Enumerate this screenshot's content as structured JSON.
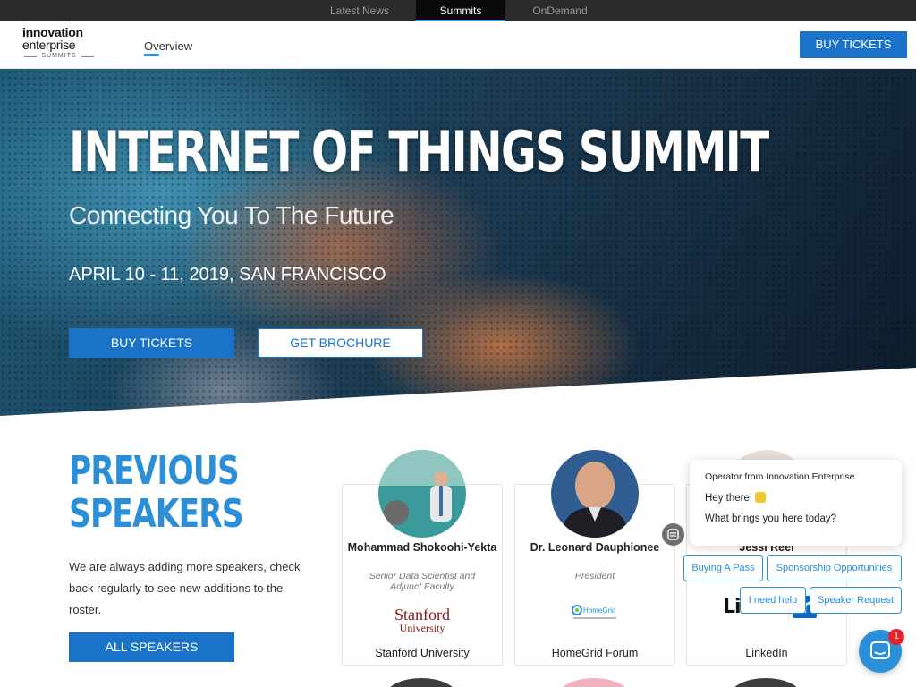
{
  "topnav": {
    "items": [
      "Latest News",
      "Summits",
      "OnDemand"
    ],
    "active": "Summits"
  },
  "header": {
    "logo": {
      "line1": "innovation",
      "line2": "enterprise",
      "line3": "SUMMITS"
    },
    "nav_overview": "Overview",
    "buy_tickets": "BUY TICKETS"
  },
  "hero": {
    "title": "INTERNET OF THINGS SUMMIT",
    "subtitle": "Connecting You To The Future",
    "date": "APRIL 10 - 11, 2019, SAN FRANCISCO",
    "buy_tickets": "BUY TICKETS",
    "get_brochure": "GET BROCHURE"
  },
  "speakers_section": {
    "title_line1": "PREVIOUS",
    "title_line2": "SPEAKERS",
    "description": "We are always adding more speakers, check back regularly to see new additions to the roster.",
    "all_speakers": "ALL SPEAKERS",
    "speakers": [
      {
        "name": "Mohammad Shokoohi-Yekta",
        "role": "Senior Data Scientist and Adjunct Faculty",
        "company": "Stanford University",
        "logo_line1": "Stanford",
        "logo_line2": "University"
      },
      {
        "name": "Dr. Leonard Dauphionee",
        "role": "President",
        "company": "HomeGrid Forum",
        "logo_text": "HomeGrid"
      },
      {
        "name": "Jessi Reel",
        "role": "",
        "company": "LinkedIn",
        "logo_text": "Linked",
        "logo_in": "in"
      }
    ]
  },
  "chat": {
    "operator": "Operator from Innovation Enterprise",
    "line1": "Hey there!",
    "line2": "What brings you here today?",
    "quick_replies": [
      "Buying A Pass",
      "Sponsorship Opportunities",
      "I need help",
      "Speaker Request"
    ],
    "badge_count": "1"
  },
  "colors": {
    "accent": "#1a73c9",
    "heading_blue": "#2a8fd8",
    "topbar": "#2b2b2b"
  }
}
